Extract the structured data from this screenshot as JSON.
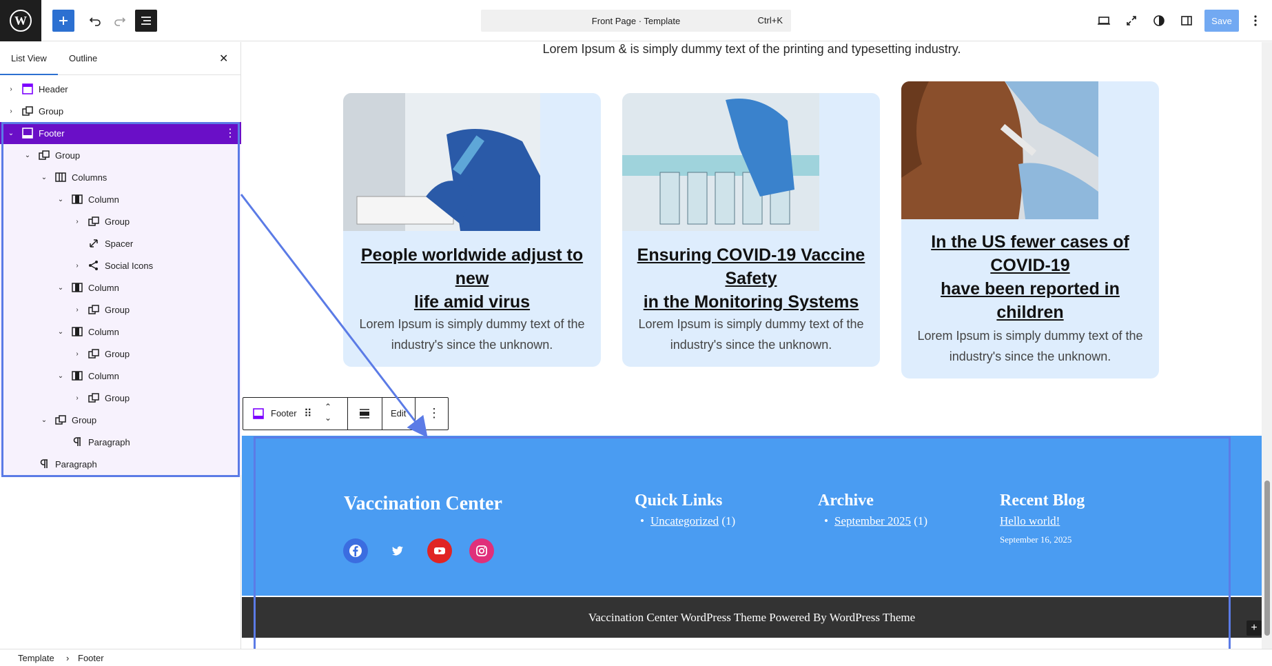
{
  "topbar": {
    "command_bar_label": "Front Page · Template",
    "command_shortcut": "Ctrl+K",
    "save_label": "Save"
  },
  "sidebar": {
    "tab_list_view": "List View",
    "tab_outline": "Outline",
    "tree": [
      {
        "label": "Header",
        "icon": "template-part-icon",
        "expanded": false
      },
      {
        "label": "Group",
        "icon": "group-icon",
        "expanded": false
      },
      {
        "label": "Footer",
        "icon": "template-part-icon",
        "expanded": true,
        "selected": true
      },
      {
        "label": "Group",
        "icon": "group-icon",
        "expanded": true
      },
      {
        "label": "Columns",
        "icon": "columns-icon",
        "expanded": true
      },
      {
        "label": "Column",
        "icon": "column-icon",
        "expanded": true
      },
      {
        "label": "Group",
        "icon": "group-icon",
        "expanded": false
      },
      {
        "label": "Spacer",
        "icon": "spacer-icon"
      },
      {
        "label": "Social Icons",
        "icon": "share-icon",
        "expanded": false
      },
      {
        "label": "Column",
        "icon": "column-icon",
        "expanded": true
      },
      {
        "label": "Group",
        "icon": "group-icon",
        "expanded": false
      },
      {
        "label": "Column",
        "icon": "column-icon",
        "expanded": true
      },
      {
        "label": "Group",
        "icon": "group-icon",
        "expanded": false
      },
      {
        "label": "Column",
        "icon": "column-icon",
        "expanded": true
      },
      {
        "label": "Group",
        "icon": "group-icon",
        "expanded": false
      },
      {
        "label": "Group",
        "icon": "group-icon",
        "expanded": true
      },
      {
        "label": "Paragraph",
        "icon": "paragraph-icon"
      },
      {
        "label": "Paragraph",
        "icon": "paragraph-icon"
      }
    ]
  },
  "breadcrumb": {
    "root": "Template",
    "current": "Footer"
  },
  "canvas": {
    "intro": "Lorem Ipsum & is simply dummy text of the printing and typesetting industry.",
    "cards": [
      {
        "title_lines": [
          "People worldwide adjust to",
          "new",
          "life amid virus"
        ],
        "text_lines": [
          "Lorem Ipsum is simply dummy text of the",
          "industry's since the unknown."
        ]
      },
      {
        "title_lines": [
          "Ensuring COVID-19 Vaccine",
          "Safety",
          "in the Monitoring Systems"
        ],
        "text_lines": [
          "Lorem Ipsum is simply dummy text of the",
          "industry's since the unknown."
        ]
      },
      {
        "title_lines": [
          "In the US fewer cases of",
          "COVID-19",
          "have been reported in",
          "children"
        ],
        "text_lines": [
          "Lorem Ipsum is simply dummy text of the",
          "industry's since the unknown."
        ]
      }
    ],
    "block_toolbar": {
      "block_name": "Footer",
      "edit_label": "Edit"
    },
    "footer": {
      "brand": "Vaccination Center",
      "quick_links_title": "Quick Links",
      "quick_link": "Uncategorized",
      "quick_link_count": "(1)",
      "archive_title": "Archive",
      "archive_link": "September 2025",
      "archive_count": "(1)",
      "recent_title": "Recent Blog",
      "recent_post": "Hello world!",
      "recent_date": "September 16, 2025",
      "copyright": "Vaccination Center WordPress Theme Powered By WordPress Theme"
    }
  },
  "colors": {
    "selection": "#6a0fc7",
    "accent": "#2c70d1",
    "footer_bg": "#4a9cf2",
    "footer_bottom": "#333333",
    "card_bg": "#deedfd"
  }
}
